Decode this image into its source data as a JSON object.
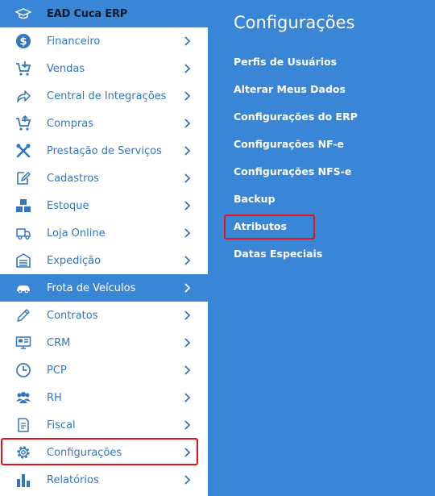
{
  "brand": {
    "label": "EAD Cuca ERP",
    "icon": "graduation-cap-icon"
  },
  "sidebar": {
    "items": [
      {
        "label": "Financeiro",
        "icon": "dollar-icon"
      },
      {
        "label": "Vendas",
        "icon": "cart-icon"
      },
      {
        "label": "Central de Integrações",
        "icon": "share-icon"
      },
      {
        "label": "Compras",
        "icon": "cart-icon"
      },
      {
        "label": "Prestação de Serviços",
        "icon": "tools-icon"
      },
      {
        "label": "Cadastros",
        "icon": "edit-icon"
      },
      {
        "label": "Estoque",
        "icon": "boxes-icon"
      },
      {
        "label": "Loja Online",
        "icon": "truck-icon"
      },
      {
        "label": "Expedição",
        "icon": "warehouse-icon"
      },
      {
        "label": "Frota de Veículos",
        "icon": "car-icon",
        "active": true
      },
      {
        "label": "Contratos",
        "icon": "pen-icon"
      },
      {
        "label": "CRM",
        "icon": "monitor-icon"
      },
      {
        "label": "PCP",
        "icon": "clock-icon"
      },
      {
        "label": "RH",
        "icon": "users-icon"
      },
      {
        "label": "Fiscal",
        "icon": "document-icon"
      },
      {
        "label": "Configurações",
        "icon": "gear-icon",
        "highlighted": true
      },
      {
        "label": "Relatórios",
        "icon": "bar-chart-icon"
      }
    ]
  },
  "panel": {
    "title": "Configurações",
    "items": [
      {
        "label": "Perfis de Usuários"
      },
      {
        "label": "Alterar Meus Dados"
      },
      {
        "label": "Configurações do ERP"
      },
      {
        "label": "Configurações NF-e"
      },
      {
        "label": "Configurações NFS-e"
      },
      {
        "label": "Backup"
      },
      {
        "label": "Atributos",
        "highlighted": true
      },
      {
        "label": "Datas Especiais"
      }
    ]
  },
  "colors": {
    "accent": "#3a86d6",
    "icon": "#3575be",
    "highlight": "#e8101c",
    "white": "#ffffff"
  }
}
